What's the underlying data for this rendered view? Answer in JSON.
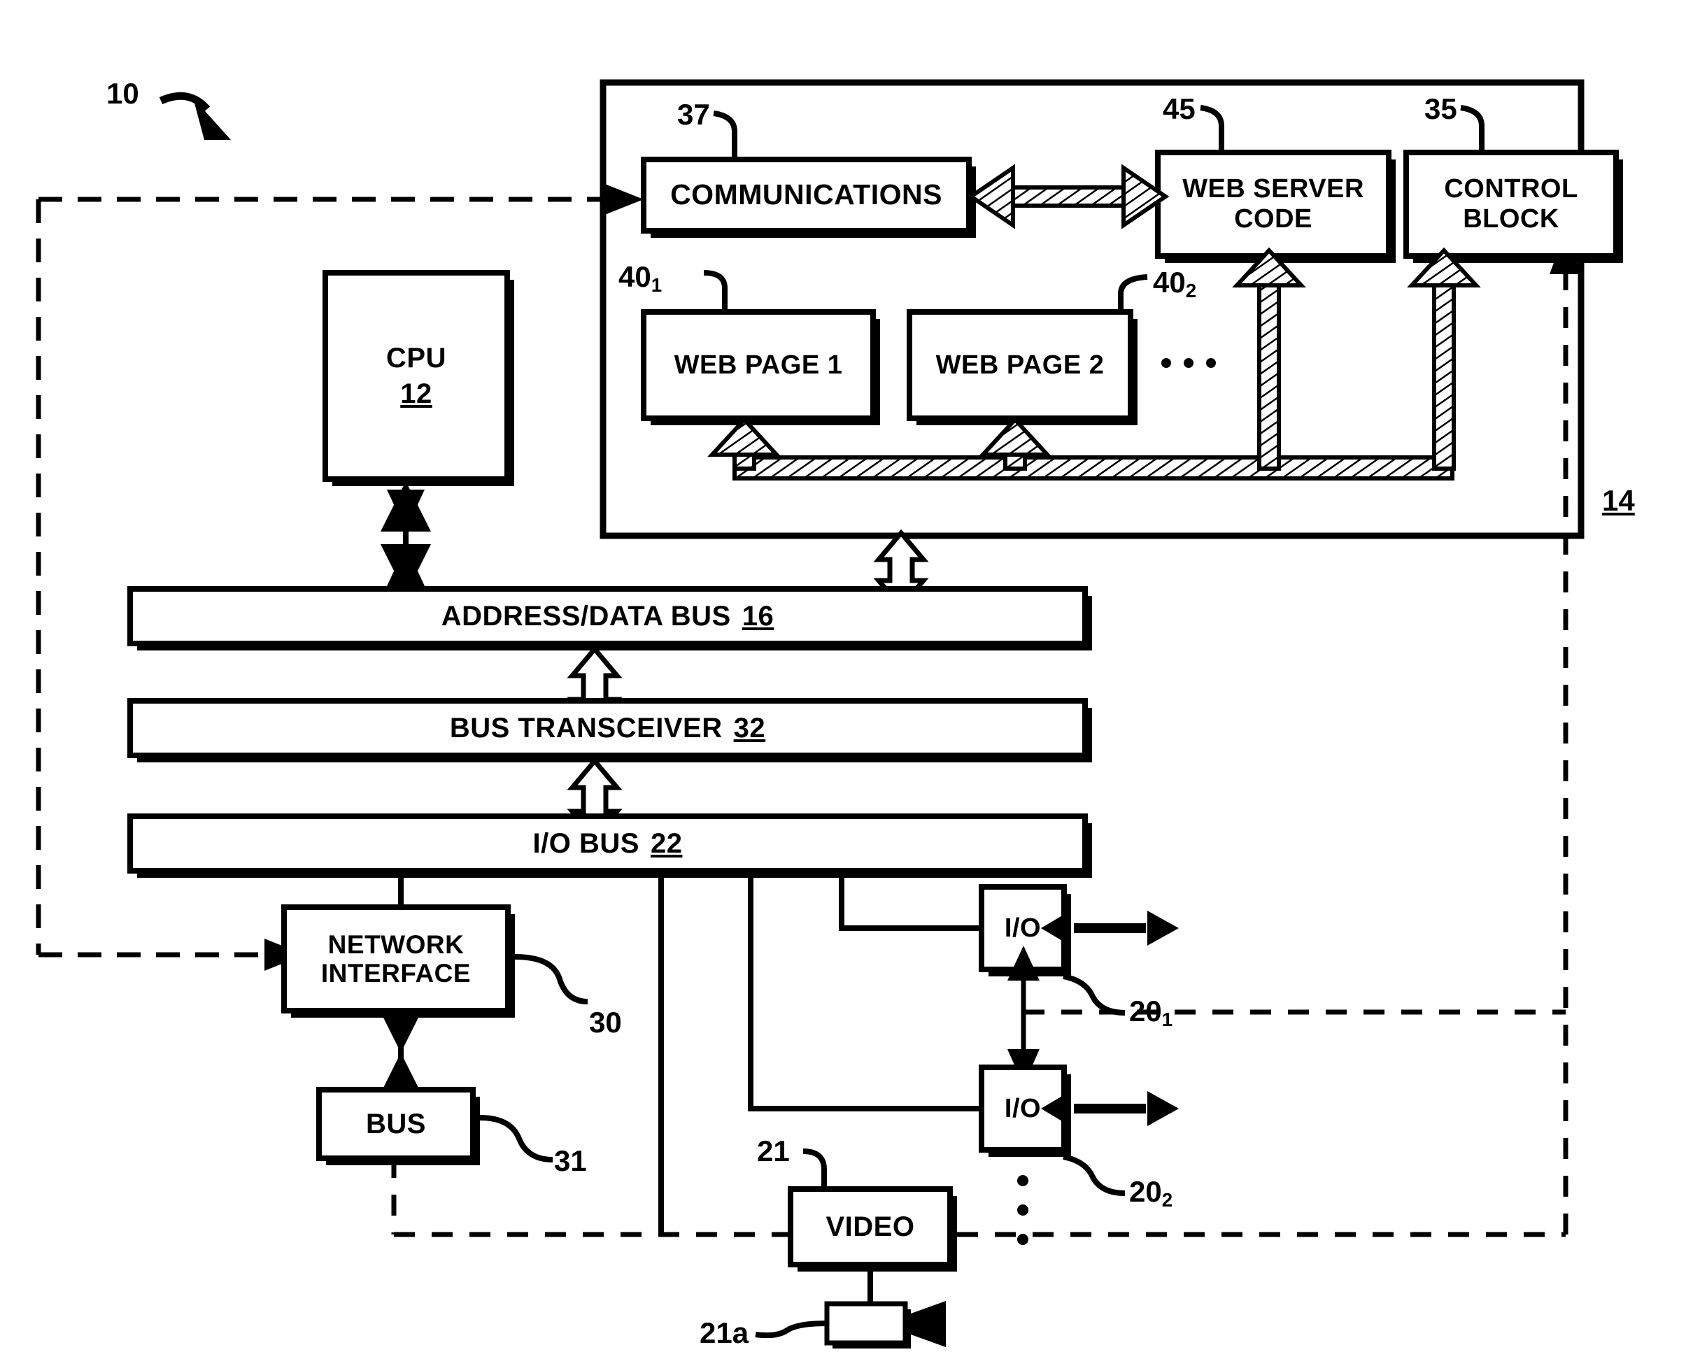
{
  "figure": {
    "system_ref": "10",
    "memory_block_ref": "14"
  },
  "blocks": [
    {
      "id": "communications",
      "label": "COMMUNICATIONS",
      "ref": "37",
      "ref_sub": ""
    },
    {
      "id": "web-server-code",
      "label": "WEB SERVER\nCODE",
      "ref": "45",
      "ref_sub": ""
    },
    {
      "id": "control-block",
      "label": "CONTROL\nBLOCK",
      "ref": "35",
      "ref_sub": ""
    },
    {
      "id": "web-page-1",
      "label": "WEB PAGE 1",
      "ref": "40",
      "ref_sub": "1"
    },
    {
      "id": "web-page-2",
      "label": "WEB PAGE 2",
      "ref": "40",
      "ref_sub": "2"
    },
    {
      "id": "cpu",
      "label": "CPU",
      "ref": "12",
      "ref_sub": ""
    },
    {
      "id": "address-data-bus",
      "label": "ADDRESS/DATA BUS",
      "ref": "16",
      "ref_sub": ""
    },
    {
      "id": "bus-transceiver",
      "label": "BUS TRANSCEIVER",
      "ref": "32",
      "ref_sub": ""
    },
    {
      "id": "io-bus",
      "label": "I/O BUS",
      "ref": "22",
      "ref_sub": ""
    },
    {
      "id": "network-interface",
      "label": "NETWORK\nINTERFACE",
      "ref": "30",
      "ref_sub": ""
    },
    {
      "id": "bus",
      "label": "BUS",
      "ref": "31",
      "ref_sub": ""
    },
    {
      "id": "io-1",
      "label": "I/O",
      "ref": "20",
      "ref_sub": "1"
    },
    {
      "id": "io-2",
      "label": "I/O",
      "ref": "20",
      "ref_sub": "2"
    },
    {
      "id": "video",
      "label": "VIDEO",
      "ref": "21",
      "ref_sub": ""
    },
    {
      "id": "camera",
      "label": "",
      "ref": "21a",
      "ref_sub": ""
    }
  ],
  "text": {
    "communications": "COMMUNICATIONS",
    "web_server_code_line1": "WEB SERVER",
    "web_server_code_line2": "CODE",
    "control_block_line1": "CONTROL",
    "control_block_line2": "BLOCK",
    "web_page_1": "WEB PAGE 1",
    "web_page_2": "WEB PAGE 2",
    "cpu": "CPU",
    "cpu_num": "12",
    "address_data_bus": "ADDRESS/DATA BUS",
    "address_data_bus_num": "16",
    "bus_transceiver": "BUS TRANSCEIVER",
    "bus_transceiver_num": "32",
    "io_bus": "I/O BUS",
    "io_bus_num": "22",
    "network_interface_line1": "NETWORK",
    "network_interface_line2": "INTERFACE",
    "bus": "BUS",
    "io": "I/O",
    "video": "VIDEO"
  },
  "refs": {
    "r10": "10",
    "r37": "37",
    "r45": "45",
    "r35": "35",
    "r40_base": "40",
    "r40_1_sub": "1",
    "r40_2_sub": "2",
    "r14": "14",
    "r30": "30",
    "r31": "31",
    "r20_base": "20",
    "r20_1_sub": "1",
    "r20_2_sub": "2",
    "r21": "21",
    "r21a": "21a"
  },
  "colors": {
    "line": "#000000",
    "fill": "#ffffff",
    "shadow": "#000000"
  }
}
